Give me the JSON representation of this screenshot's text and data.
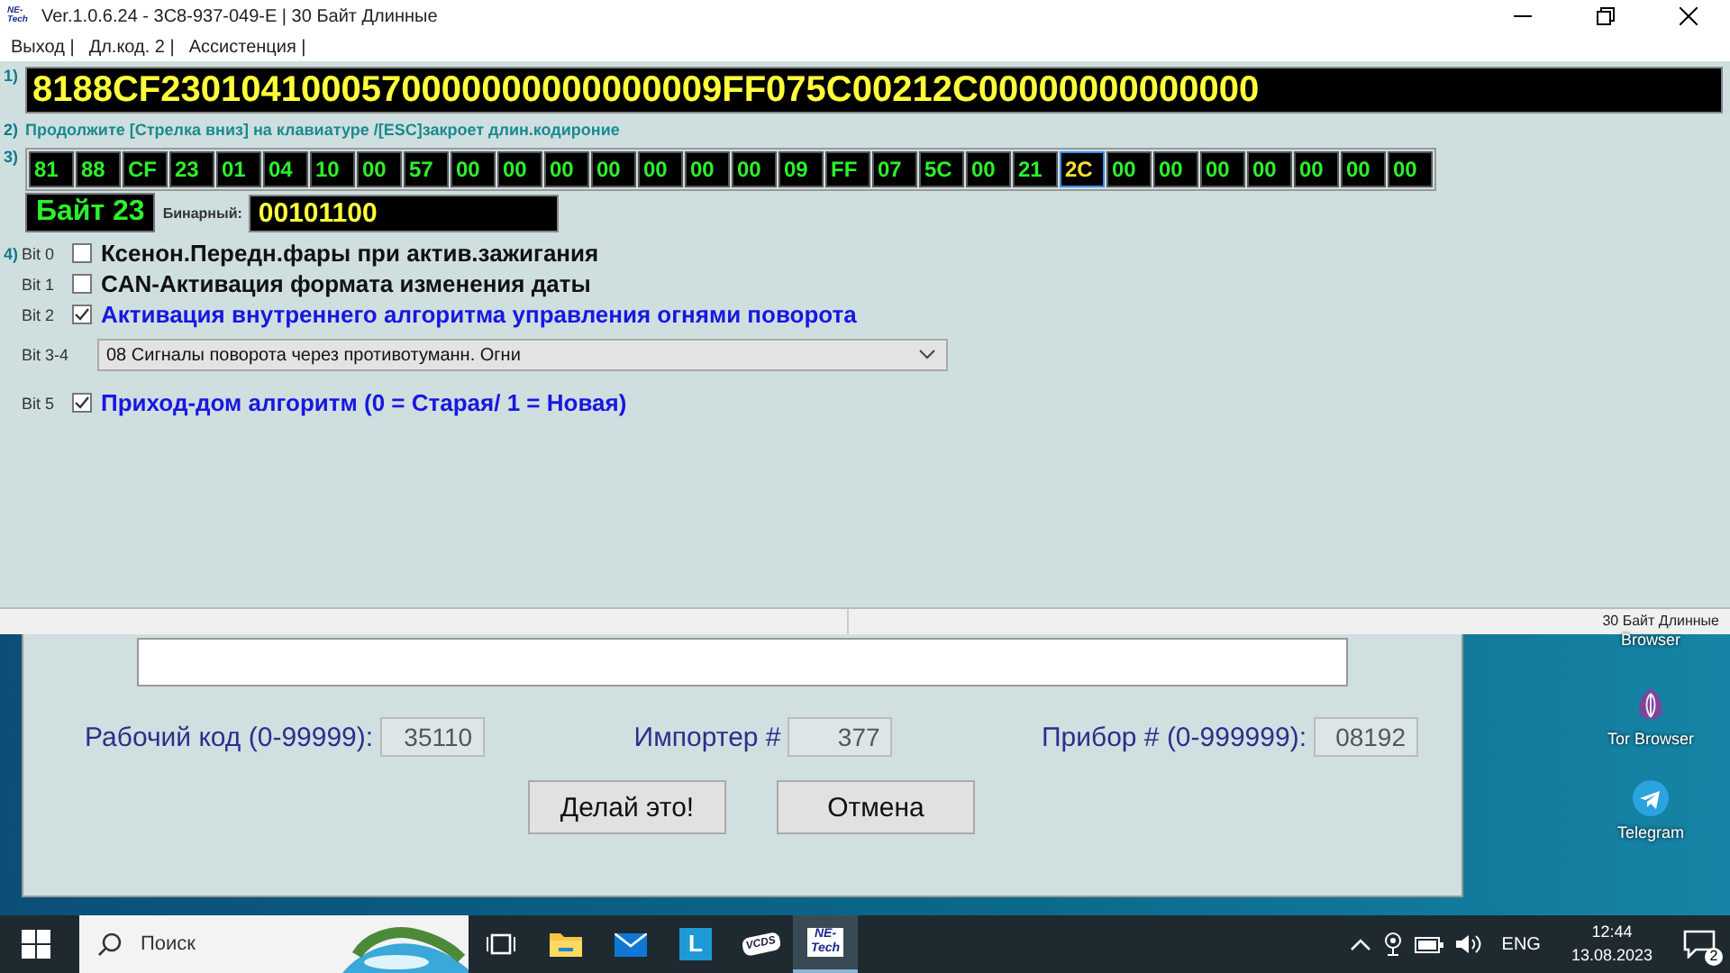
{
  "window": {
    "title": "Ver.1.0.6.24 -   3C8-937-049-E | 30 Байт Длинные",
    "app_icon_label": "NE-Tech"
  },
  "menu": [
    "Выход |",
    "Дл.код. 2 |",
    "Ассистенция |"
  ],
  "code_line": {
    "label": "1)",
    "value": "8188CF2301041000570000000000000009FF075C00212C00000000000000"
  },
  "hint": {
    "label": "2)",
    "text": "Продолжите [Стрелка вниз] на клавиатуре /[ESC]закроет длин.кодироние"
  },
  "bytes": {
    "label": "3)",
    "items": [
      {
        "value": "81",
        "selected": false
      },
      {
        "value": "88",
        "selected": false
      },
      {
        "value": "CF",
        "selected": false
      },
      {
        "value": "23",
        "selected": false
      },
      {
        "value": "01",
        "selected": false
      },
      {
        "value": "04",
        "selected": false
      },
      {
        "value": "10",
        "selected": false
      },
      {
        "value": "00",
        "selected": false
      },
      {
        "value": "57",
        "selected": false
      },
      {
        "value": "00",
        "selected": false
      },
      {
        "value": "00",
        "selected": false
      },
      {
        "value": "00",
        "selected": false
      },
      {
        "value": "00",
        "selected": false
      },
      {
        "value": "00",
        "selected": false
      },
      {
        "value": "00",
        "selected": false
      },
      {
        "value": "00",
        "selected": false
      },
      {
        "value": "09",
        "selected": false
      },
      {
        "value": "FF",
        "selected": false
      },
      {
        "value": "07",
        "selected": false
      },
      {
        "value": "5C",
        "selected": false
      },
      {
        "value": "00",
        "selected": false
      },
      {
        "value": "21",
        "selected": false
      },
      {
        "value": "2C",
        "selected": true
      },
      {
        "value": "00",
        "selected": false
      },
      {
        "value": "00",
        "selected": false
      },
      {
        "value": "00",
        "selected": false
      },
      {
        "value": "00",
        "selected": false
      },
      {
        "value": "00",
        "selected": false
      },
      {
        "value": "00",
        "selected": false
      },
      {
        "value": "00",
        "selected": false
      }
    ]
  },
  "byte_info": {
    "title": "Байт 23",
    "binary_label": "Бинарный:",
    "binary": "00101100"
  },
  "bits_label": "4)",
  "bits": [
    {
      "kind": "checkbox",
      "label": "Bit 0",
      "text": "Ксенон.Передн.фары при актив.зажигания",
      "checked": false
    },
    {
      "kind": "checkbox",
      "label": "Bit 1",
      "text": "CAN-Активация формата изменения даты",
      "checked": false
    },
    {
      "kind": "checkbox",
      "label": "Bit 2",
      "text": "Активация внутреннего алгоритма управления огнями поворота",
      "checked": true
    },
    {
      "kind": "dropdown",
      "label": "Bit 3-4",
      "value": "08 Сигналы поворота через противотуманн. Огни"
    },
    {
      "kind": "checkbox",
      "label": "Bit 5",
      "text": "Приход-дом алгоритм (0 = Старая/ 1 = Новая)",
      "checked": true
    }
  ],
  "status_bar": [
    "30 Байт Длинные"
  ],
  "dialog": {
    "fields": [
      {
        "label": "Рабочий код (0-99999):",
        "value": "35110"
      },
      {
        "label": "Импортер #",
        "value": "377"
      },
      {
        "label": "Прибор # (0-999999):",
        "value": "08192"
      }
    ],
    "buttons": [
      "Делай это!",
      "Отмена"
    ]
  },
  "desktop_icons": [
    {
      "kind": "browser",
      "label": "Browser"
    },
    {
      "kind": "tor",
      "label": "Tor Browser"
    },
    {
      "kind": "telegram",
      "label": "Telegram"
    }
  ],
  "taskbar": {
    "search_placeholder": "Поиск",
    "apps": [
      {
        "kind": "taskview",
        "selected": false
      },
      {
        "kind": "folder",
        "selected": false
      },
      {
        "kind": "mail",
        "selected": false
      },
      {
        "kind": "letter",
        "label": "L",
        "selected": false
      },
      {
        "kind": "vcds",
        "label": "VCDS",
        "selected": false
      },
      {
        "kind": "netech",
        "label": "NE-Tech",
        "selected": true
      }
    ],
    "language": "ENG",
    "time": "12:44",
    "date": "13.08.2023",
    "notifications": "2"
  }
}
